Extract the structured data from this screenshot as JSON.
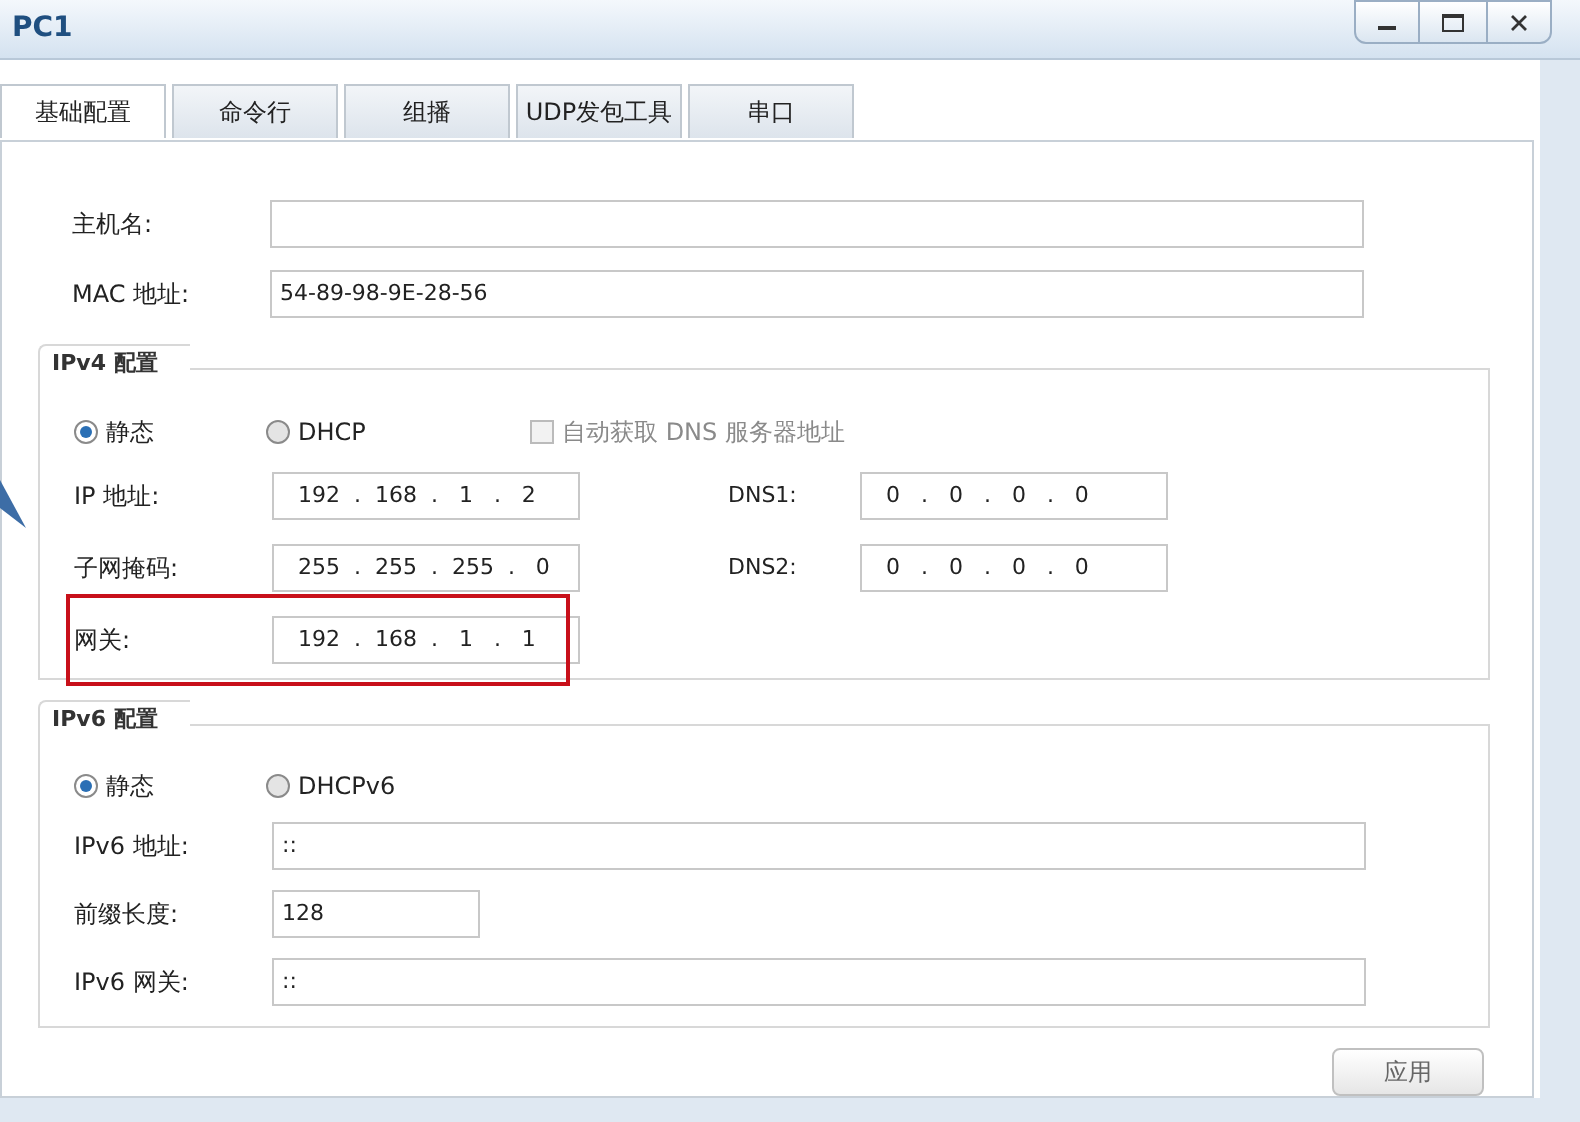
{
  "window": {
    "title": "PC1"
  },
  "tabs": [
    {
      "label": "基础配置",
      "selected": true
    },
    {
      "label": "命令行",
      "selected": false
    },
    {
      "label": "组播",
      "selected": false
    },
    {
      "label": "UDP发包工具",
      "selected": false
    },
    {
      "label": "串口",
      "selected": false
    }
  ],
  "host": [
    {
      "label": "主机名:"
    },
    {
      "label": "MAC 地址:",
      "value": "54-89-98-9E-28-56"
    }
  ],
  "ipv4": {
    "title": "IPv4 配置",
    "modes": [
      {
        "label": "静态",
        "selected": true
      },
      {
        "label": "DHCP",
        "selected": false
      }
    ],
    "dns_auto": {
      "label": "自动获取 DNS 服务器地址",
      "checked": false,
      "disabled": true
    },
    "rows": [
      {
        "label": "IP 地址:",
        "value": "192  .  168  .   1   .   2",
        "dns_label": "DNS1:",
        "dns_value": "0   .   0   .   0   .   0",
        "highlighted": false
      },
      {
        "label": "子网掩码:",
        "value": "255  .  255  .  255  .   0",
        "dns_label": "DNS2:",
        "dns_value": "0   .   0   .   0   .   0",
        "highlighted": false
      },
      {
        "label": "网关:",
        "value": "192  .  168  .   1   .   1",
        "highlighted": true
      }
    ]
  },
  "ipv6": {
    "title": "IPv6 配置",
    "modes": [
      {
        "label": "静态",
        "selected": true
      },
      {
        "label": "DHCPv6",
        "selected": false
      }
    ],
    "fields": [
      {
        "label": "IPv6 地址:",
        "value": "::",
        "kind": "wide"
      },
      {
        "label": "前缀长度:",
        "value": "128",
        "kind": "short"
      },
      {
        "label": "IPv6 网关:",
        "value": "::",
        "kind": "wide"
      }
    ]
  },
  "apply_button": "应用"
}
